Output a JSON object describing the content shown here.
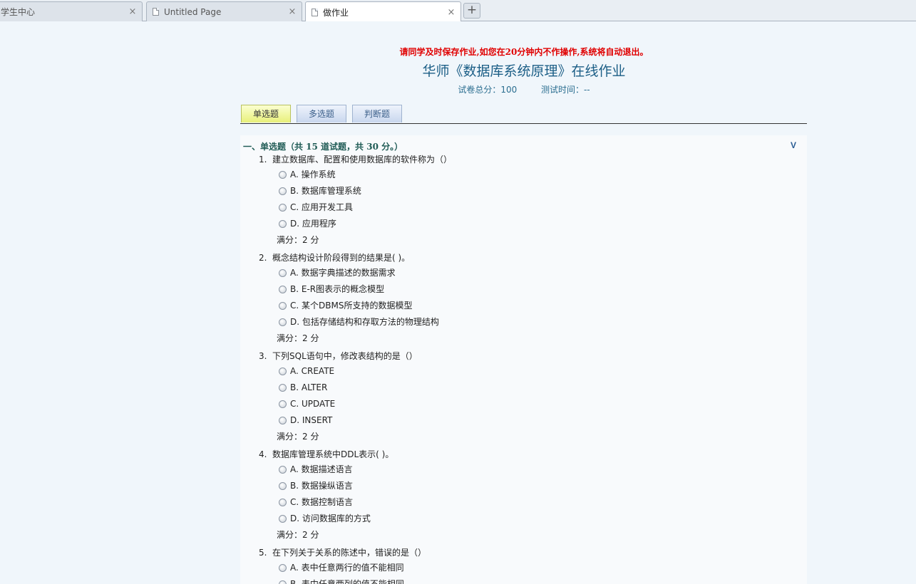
{
  "browser": {
    "tabs": [
      {
        "title": "学生中心"
      },
      {
        "title": "Untitled Page"
      },
      {
        "title": "做作业"
      }
    ],
    "close_glyph": "×",
    "new_tab_glyph": "+"
  },
  "page": {
    "notice": "请同学及时保存作业,如您在20分钟内不作操作,系统将自动退出。",
    "title": "华师《数据库系统原理》在线作业",
    "total_score_label": "试卷总分：",
    "total_score": "100",
    "time_label": "测试时间：",
    "time_value": "--",
    "question_tabs": [
      "单选题",
      "多选题",
      "判断题"
    ],
    "active_tab": "单选题",
    "section": {
      "title": "一、单选题（共 15 道试题，共 30 分。）",
      "toggle": "V"
    },
    "questions": [
      {
        "num": "1.",
        "stem": "建立数据库、配置和使用数据库的软件称为（）",
        "options": [
          "A. 操作系统",
          "B. 数据库管理系统",
          "C. 应用开发工具",
          "D. 应用程序"
        ],
        "score": "满分：2  分"
      },
      {
        "num": "2.",
        "stem": "概念结构设计阶段得到的结果是( )。",
        "options": [
          "A. 数据字典描述的数据需求",
          "B. E-R图表示的概念模型",
          "C. 某个DBMS所支持的数据模型",
          "D. 包括存储结构和存取方法的物理结构"
        ],
        "score": "满分：2  分"
      },
      {
        "num": "3.",
        "stem": "下列SQL语句中，修改表结构的是（）",
        "options": [
          "A. CREATE",
          "B. ALTER",
          "C. UPDATE",
          "D. INSERT"
        ],
        "score": "满分：2  分"
      },
      {
        "num": "4.",
        "stem": "数据库管理系统中DDL表示( )。",
        "options": [
          "A. 数据描述语言",
          "B. 数据操纵语言",
          "C. 数据控制语言",
          "D. 访问数据库的方式"
        ],
        "score": "满分：2  分"
      },
      {
        "num": "5.",
        "stem": "在下列关于关系的陈述中，错误的是（）",
        "options": [
          "A. 表中任意两行的值不能相同",
          "B. 表中任意两列的值不能相同"
        ],
        "score": ""
      }
    ]
  }
}
